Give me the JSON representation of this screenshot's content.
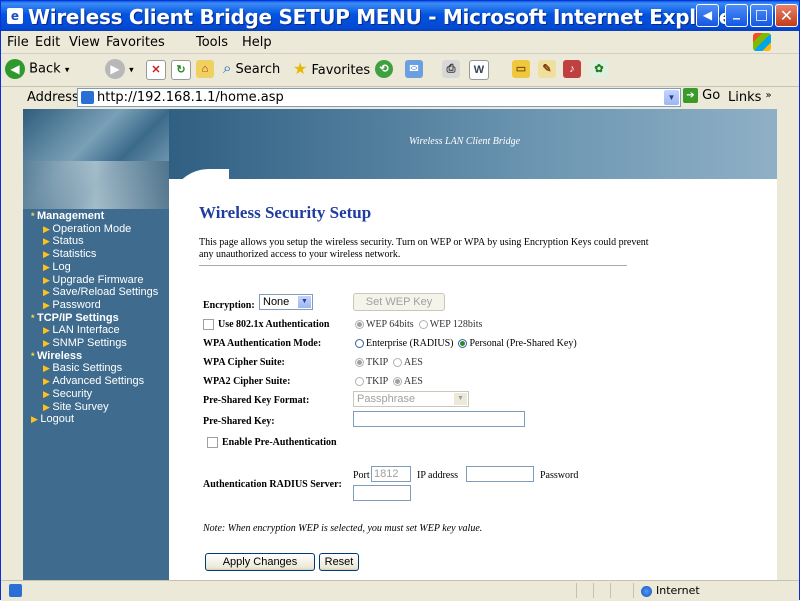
{
  "window": {
    "title": "Wireless Client Bridge SETUP MENU - Microsoft Internet Explorer"
  },
  "menubar": [
    "File",
    "Edit",
    "View",
    "Favorites",
    "Tools",
    "Help"
  ],
  "toolbar": {
    "back": "Back",
    "search": "Search",
    "favorites": "Favorites"
  },
  "address": {
    "label": "Address",
    "url": "http://192.168.1.1/home.asp",
    "go": "Go",
    "links": "Links"
  },
  "banner": {
    "text": "Wireless LAN Client Bridge"
  },
  "nav": [
    {
      "type": "section",
      "label": "Management"
    },
    {
      "type": "item",
      "label": "Operation Mode"
    },
    {
      "type": "item",
      "label": "Status"
    },
    {
      "type": "item",
      "label": "Statistics"
    },
    {
      "type": "item",
      "label": "Log"
    },
    {
      "type": "item",
      "label": "Upgrade Firmware"
    },
    {
      "type": "item",
      "label": "Save/Reload Settings"
    },
    {
      "type": "item",
      "label": "Password"
    },
    {
      "type": "section",
      "label": "TCP/IP Settings"
    },
    {
      "type": "item",
      "label": "LAN Interface"
    },
    {
      "type": "item",
      "label": "SNMP Settings"
    },
    {
      "type": "section",
      "label": "Wireless"
    },
    {
      "type": "item",
      "label": "Basic Settings"
    },
    {
      "type": "item",
      "label": "Advanced Settings"
    },
    {
      "type": "item",
      "label": "Security"
    },
    {
      "type": "item",
      "label": "Site Survey"
    },
    {
      "type": "top",
      "label": "Logout"
    }
  ],
  "page": {
    "title": "Wireless Security Setup",
    "description": "This page allows you setup the wireless security. Turn on WEP or WPA by using Encryption Keys could prevent any unauthorized access to your wireless network.",
    "encryption_label": "Encryption:",
    "encryption_value": "None",
    "set_wep_key": "Set WEP Key",
    "use_8021x": "Use 802.1x Authentication",
    "wep64": "WEP 64bits",
    "wep128": "WEP 128bits",
    "wpa_auth_mode_label": "WPA Authentication Mode:",
    "auth_enterprise": "Enterprise (RADIUS)",
    "auth_personal": "Personal (Pre-Shared Key)",
    "wpa_cipher_label": "WPA Cipher Suite:",
    "wpa2_cipher_label": "WPA2 Cipher Suite:",
    "tkip": "TKIP",
    "aes": "AES",
    "psk_format_label": "Pre-Shared Key Format:",
    "psk_format_value": "Passphrase",
    "psk_label": "Pre-Shared Key:",
    "psk_value": "",
    "enable_preauth": "Enable Pre-Authentication",
    "radius_label": "Authentication RADIUS Server:",
    "port_label": "Port",
    "port_value": "1812",
    "ip_label": "IP address",
    "ip_value": "",
    "password_label": "Password",
    "password_value": "",
    "note": "Note: When encryption WEP is selected, you must set WEP key value.",
    "apply": "Apply Changes",
    "reset": "Reset"
  },
  "status": {
    "zone": "Internet"
  }
}
